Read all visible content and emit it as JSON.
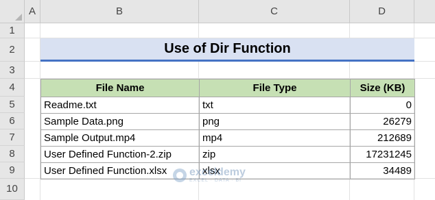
{
  "columns": [
    "A",
    "B",
    "C",
    "D"
  ],
  "rows": [
    "1",
    "2",
    "3",
    "4",
    "5",
    "6",
    "7",
    "8",
    "9",
    "10"
  ],
  "title": "Use of Dir Function",
  "table": {
    "headers": [
      "File Name",
      "File Type",
      "Size (KB)"
    ],
    "rows": [
      [
        "Readme.txt",
        "txt",
        "0"
      ],
      [
        "Sample Data.png",
        "png",
        "26279"
      ],
      [
        "Sample Output.mp4",
        "mp4",
        "212689"
      ],
      [
        "User Defined Function-2.zip",
        "zip",
        "17231245"
      ],
      [
        "User Defined Function.xlsx",
        "xlsx",
        "34489"
      ]
    ]
  },
  "watermark": {
    "name": "exceldemy",
    "tagline": "EXCEL · DATA · BI"
  },
  "colors": {
    "title_fill": "#d9e1f2",
    "title_border": "#4472c4",
    "header_fill": "#c6e0b4"
  }
}
